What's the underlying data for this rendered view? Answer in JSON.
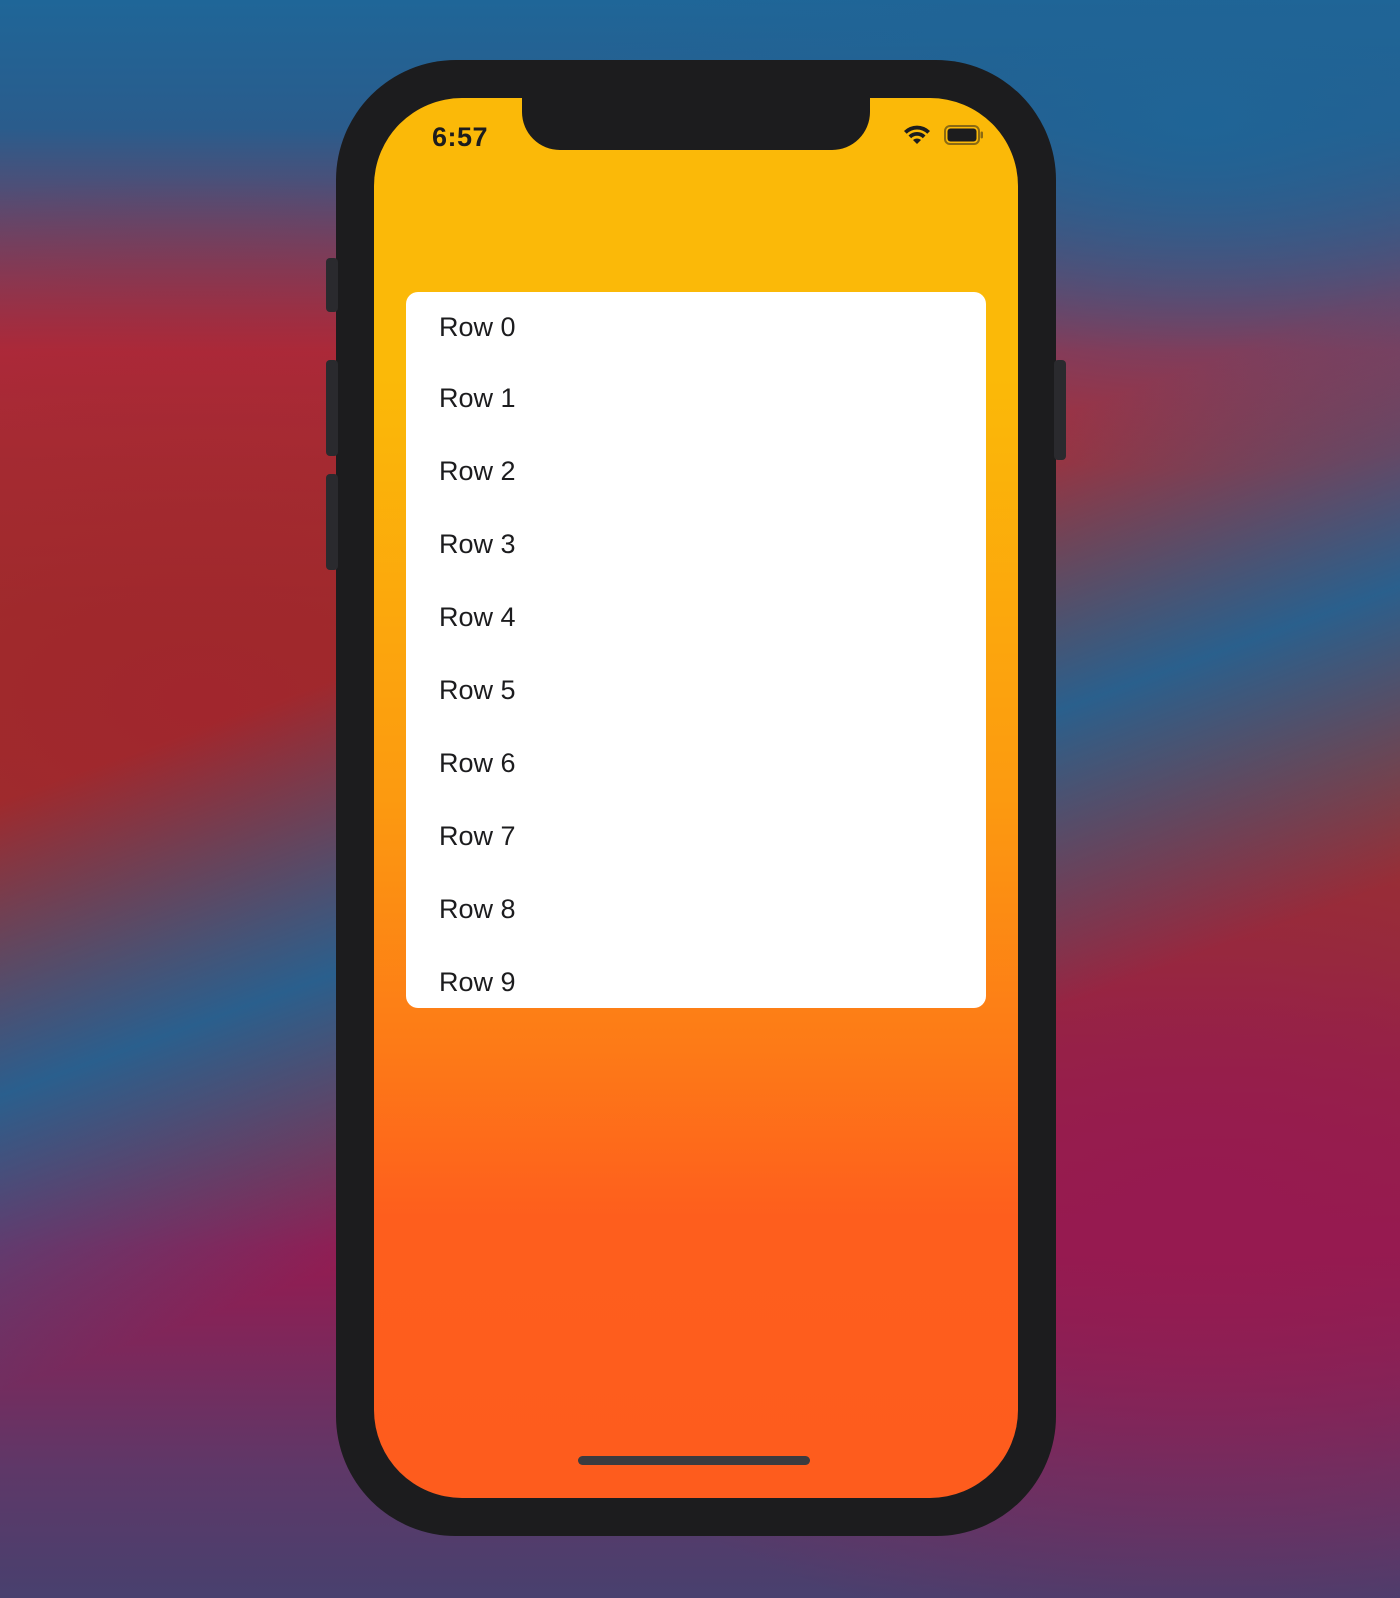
{
  "status_bar": {
    "time": "6:57",
    "icons": [
      "wifi-icon",
      "battery-icon"
    ]
  },
  "list": {
    "rows": [
      {
        "label": "Row 0"
      },
      {
        "label": "Row 1"
      },
      {
        "label": "Row 2"
      },
      {
        "label": "Row 3"
      },
      {
        "label": "Row 4"
      },
      {
        "label": "Row 5"
      },
      {
        "label": "Row 6"
      },
      {
        "label": "Row 7"
      },
      {
        "label": "Row 8"
      },
      {
        "label": "Row 9"
      }
    ]
  },
  "colors": {
    "gradient_top": "#fbb908",
    "gradient_bottom": "#fe5c1d",
    "card_background": "#ffffff",
    "device_frame": "#1c1c1e"
  }
}
